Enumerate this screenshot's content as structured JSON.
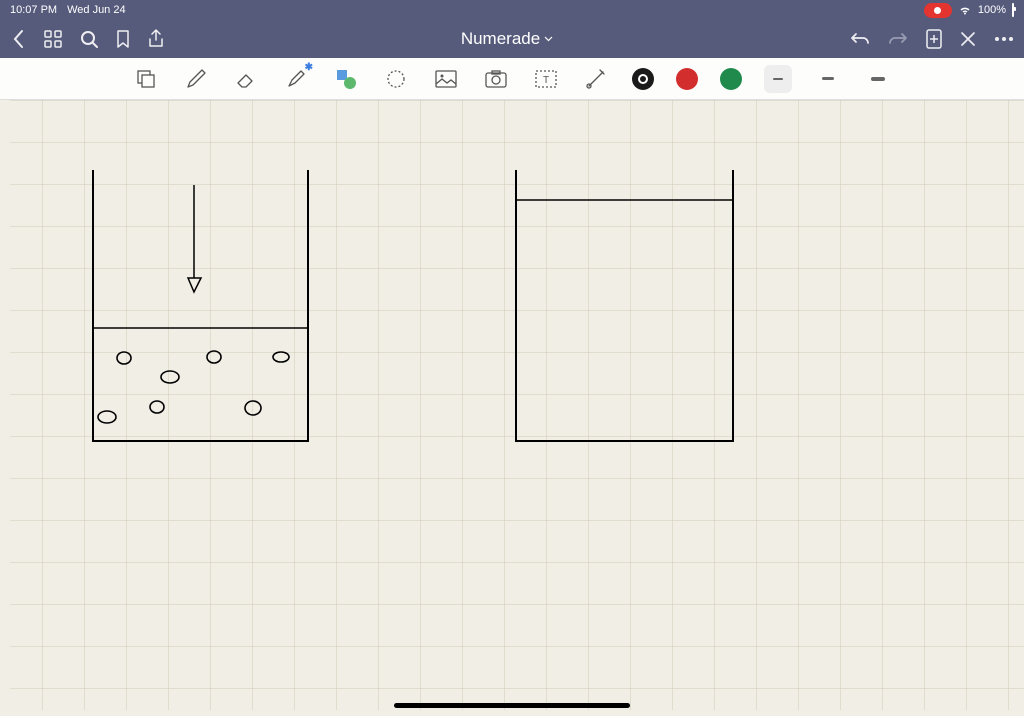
{
  "statusbar": {
    "time": "10:07 PM",
    "date": "Wed Jun 24",
    "battery_pct": "100%"
  },
  "navbar": {
    "title": "Numerade"
  },
  "toolbar": {
    "tools": {
      "shape": "shape",
      "pen": "pen",
      "eraser": "eraser",
      "highlighter": "highlighter",
      "shapes_tool": "shapes",
      "lasso": "lasso",
      "image": "image",
      "camera": "camera",
      "textbox": "textbox",
      "cord": "cord"
    },
    "colors": {
      "black": "#1a1a1a",
      "red": "#d32e2e",
      "green": "#1f8a4c"
    },
    "strokes": {
      "thin": 10,
      "medium": 12,
      "thick": 14
    }
  }
}
